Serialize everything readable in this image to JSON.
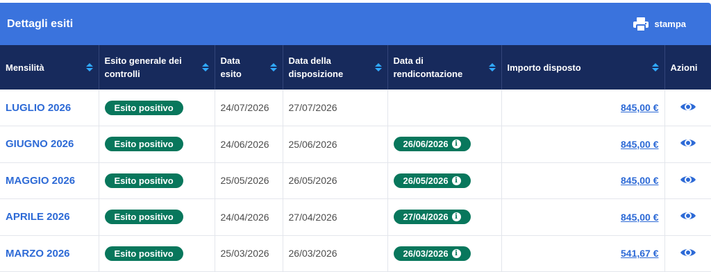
{
  "panel": {
    "title": "Dettagli esiti",
    "print_label": "stampa",
    "print_icon": "printer-icon"
  },
  "colors": {
    "header_bg": "#3a73dd",
    "table_header_bg": "#172a5c",
    "badge_bg": "#08775c",
    "link": "#2d6ad6",
    "sort_arrow": "#30a9ff"
  },
  "columns": [
    {
      "label": "Mensilità",
      "sortable": true
    },
    {
      "label": "Esito generale dei controlli",
      "sortable": true
    },
    {
      "label": "Data esito",
      "sortable": true
    },
    {
      "label": "Data della disposizione",
      "sortable": true
    },
    {
      "label": "Data di rendicontazione",
      "sortable": true
    },
    {
      "label": "Importo disposto",
      "sortable": true
    },
    {
      "label": "Azioni",
      "sortable": false
    }
  ],
  "rows": [
    {
      "month": "LUGLIO 2026",
      "esito": "Esito positivo",
      "data_esito": "24/07/2026",
      "data_disposizione": "27/07/2026",
      "data_rendicontazione": "",
      "importo": "845,00 €"
    },
    {
      "month": "GIUGNO 2026",
      "esito": "Esito positivo",
      "data_esito": "24/06/2026",
      "data_disposizione": "25/06/2026",
      "data_rendicontazione": "26/06/2026",
      "importo": "845,00 €"
    },
    {
      "month": "MAGGIO 2026",
      "esito": "Esito positivo",
      "data_esito": "25/05/2026",
      "data_disposizione": "26/05/2026",
      "data_rendicontazione": "26/05/2026",
      "importo": "845,00 €"
    },
    {
      "month": "APRILE 2026",
      "esito": "Esito positivo",
      "data_esito": "24/04/2026",
      "data_disposizione": "27/04/2026",
      "data_rendicontazione": "27/04/2026",
      "importo": "845,00 €"
    },
    {
      "month": "MARZO 2026",
      "esito": "Esito positivo",
      "data_esito": "25/03/2026",
      "data_disposizione": "26/03/2026",
      "data_rendicontazione": "26/03/2026",
      "importo": "541,67 €"
    }
  ]
}
